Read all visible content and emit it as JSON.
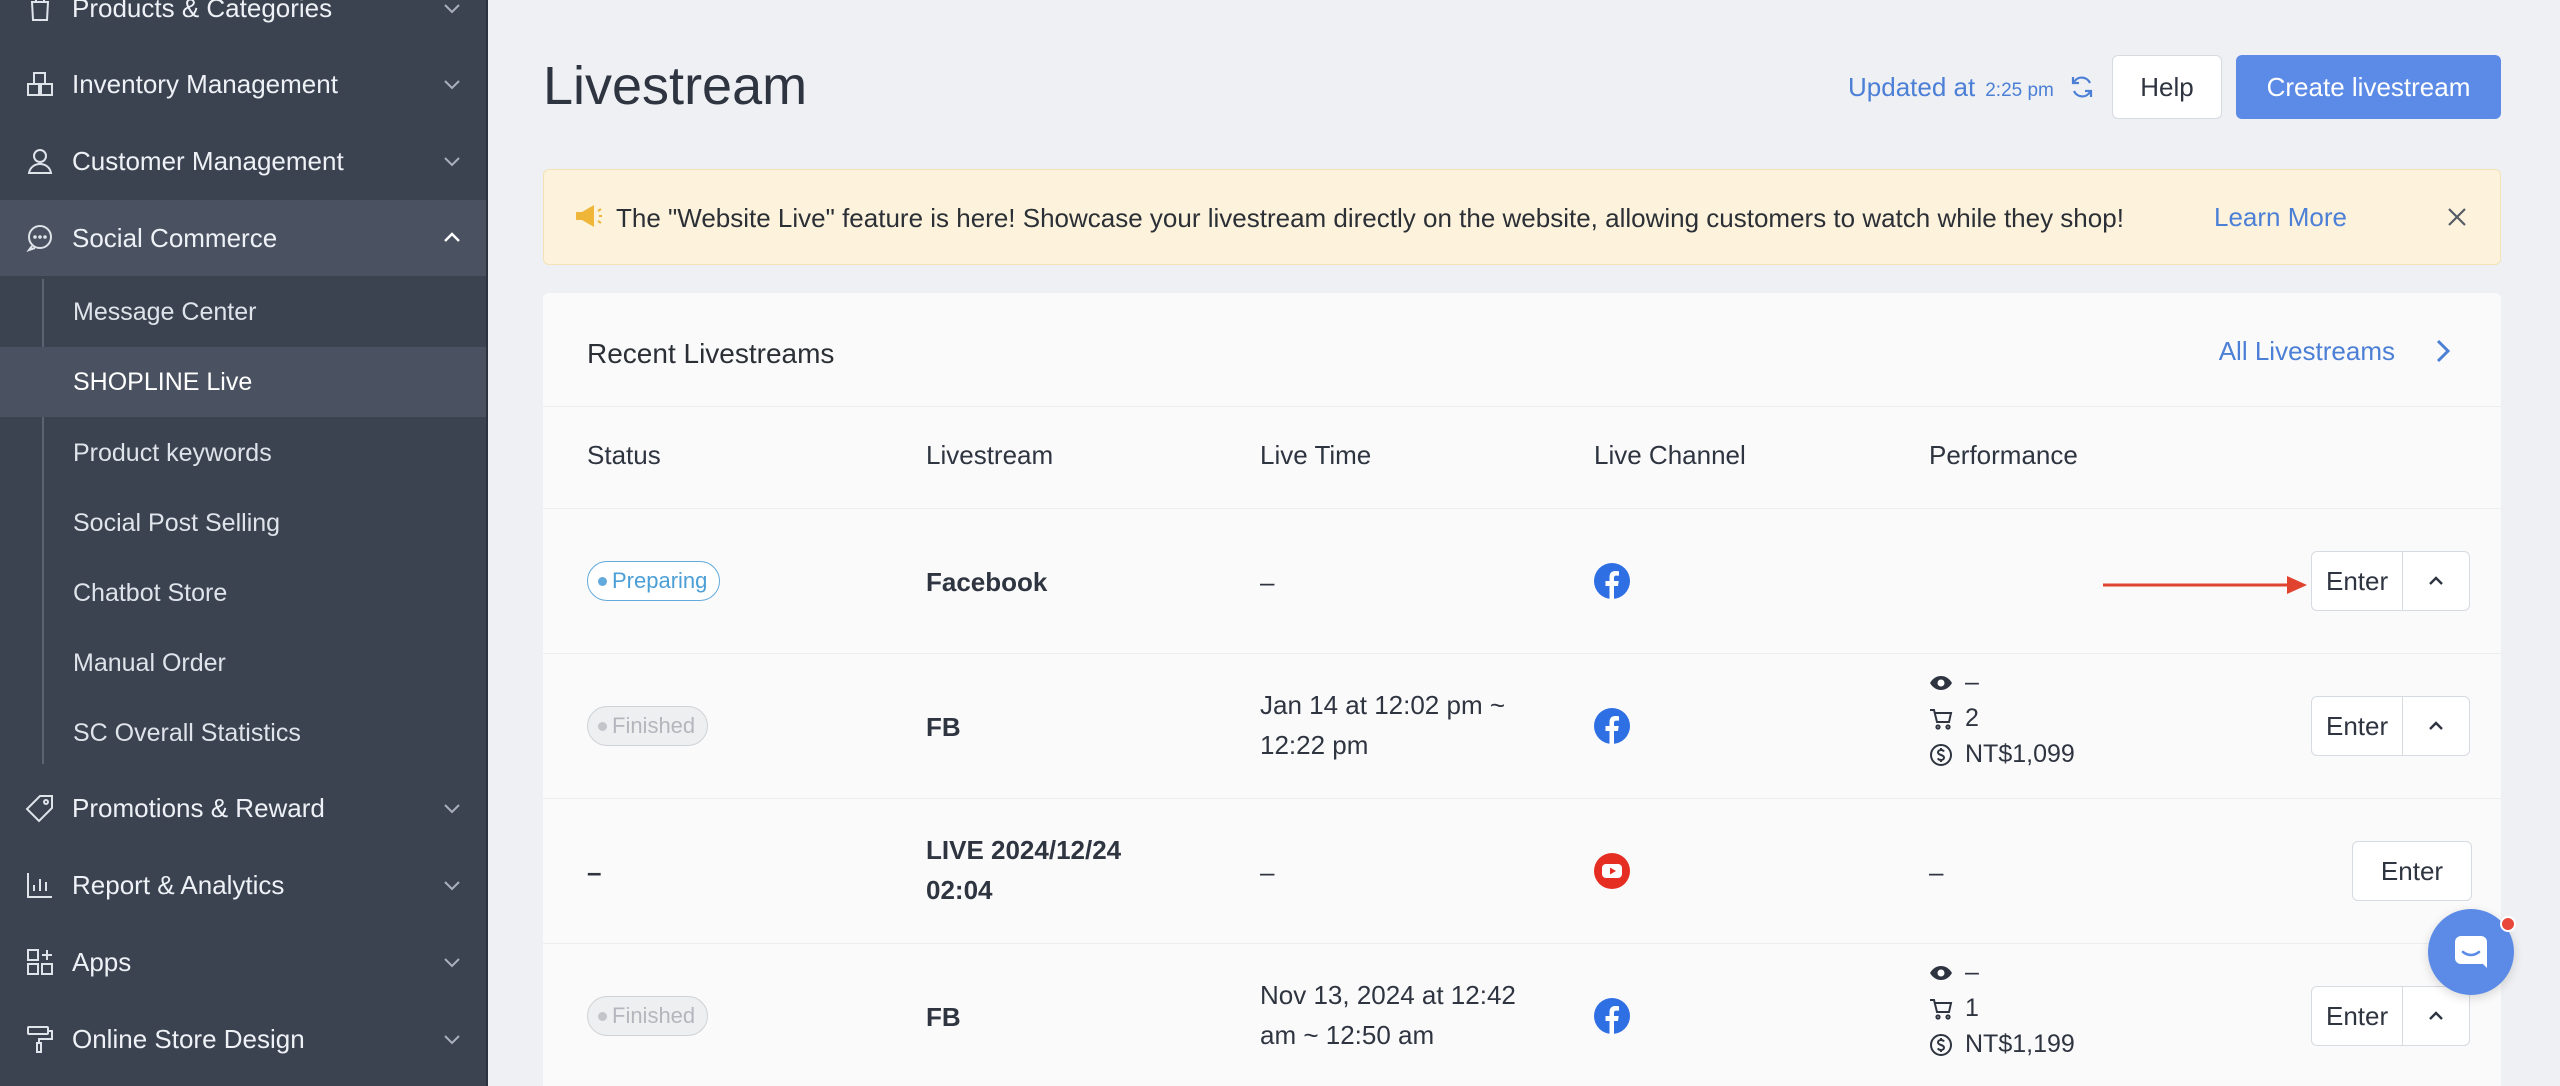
{
  "sidebar": {
    "items": [
      {
        "label": "Products & Categories",
        "icon": "bag-icon"
      },
      {
        "label": "Inventory Management",
        "icon": "boxes-icon"
      },
      {
        "label": "Customer Management",
        "icon": "person-icon"
      },
      {
        "label": "Social Commerce",
        "icon": "chat-bubble-icon",
        "expanded": true
      },
      {
        "label": "Promotions & Reward",
        "icon": "tag-icon"
      },
      {
        "label": "Report & Analytics",
        "icon": "bar-chart-icon"
      },
      {
        "label": "Apps",
        "icon": "apps-grid-icon"
      },
      {
        "label": "Online Store Design",
        "icon": "paint-roller-icon"
      }
    ],
    "sub_items": [
      {
        "label": "Message Center"
      },
      {
        "label": "SHOPLINE Live",
        "active": true
      },
      {
        "label": "Product keywords"
      },
      {
        "label": "Social Post Selling"
      },
      {
        "label": "Chatbot Store"
      },
      {
        "label": "Manual Order"
      },
      {
        "label": "SC Overall Statistics"
      }
    ]
  },
  "header": {
    "title": "Livestream",
    "updated_label": "Updated at",
    "updated_time": "2:25 pm",
    "help_label": "Help",
    "create_label": "Create livestream"
  },
  "banner": {
    "text": "The \"Website Live\" feature is here! Showcase your livestream directly on the website, allowing customers to watch while they shop!",
    "link": "Learn More"
  },
  "recent": {
    "title": "Recent Livestreams",
    "all_link": "All Livestreams",
    "columns": [
      "Status",
      "Livestream",
      "Live Time",
      "Live Channel",
      "Performance"
    ],
    "rows": [
      {
        "status": "Preparing",
        "name": "Facebook",
        "time": "–",
        "channel": "facebook",
        "views": "",
        "orders": "",
        "sales": "",
        "perf": "",
        "enter": "Enter"
      },
      {
        "status": "Finished",
        "name": "FB",
        "time_line1": "Jan 14 at 12:02 pm ~",
        "time_line2": "12:22 pm",
        "channel": "facebook",
        "views": "–",
        "orders": "2",
        "sales": "NT$1,099",
        "enter": "Enter"
      },
      {
        "status": "–",
        "name_line1": "LIVE 2024/12/24",
        "name_line2": "02:04",
        "time": "–",
        "channel": "youtube",
        "perf": "–",
        "enter": "Enter"
      },
      {
        "status": "Finished",
        "name": "FB",
        "time_line1": "Nov 13, 2024 at 12:42",
        "time_line2": "am ~ 12:50 am",
        "channel": "facebook",
        "views": "–",
        "orders": "1",
        "sales": "NT$1,199",
        "enter": "Enter"
      }
    ]
  },
  "colors": {
    "sidebar_bg": "#3b4250",
    "accent": "#5b8be6",
    "link": "#4c7fd6",
    "banner_bg": "#fdf3dc",
    "arrow": "#e0432f"
  }
}
